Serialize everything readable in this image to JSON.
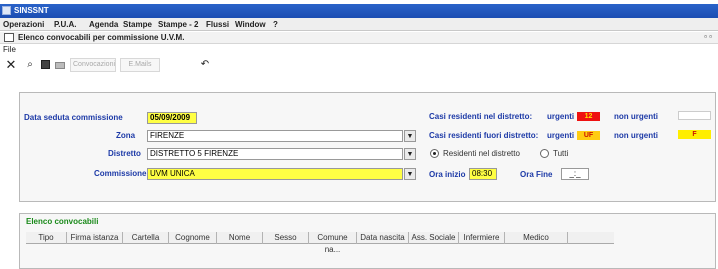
{
  "app": {
    "title": "SINSSNT"
  },
  "menu": [
    "Operazioni",
    "P.U.A.",
    "Agenda",
    "Stampe",
    "Stampe - 2",
    "Flussi",
    "Window",
    "?"
  ],
  "window": {
    "title": "Elenco convocabili per commissione U.V.M.",
    "controls": "▫ ▫"
  },
  "file_menu": "File",
  "toolbar": {
    "convocazioni": "Convocazioni",
    "emails": "E.Mails"
  },
  "form": {
    "data_seduta": {
      "label": "Data seduta commissione",
      "value": "05/09/2009"
    },
    "zona": {
      "label": "Zona",
      "value": "FIRENZE"
    },
    "distretto": {
      "label": "Distretto",
      "value": "DISTRETTO 5 FIRENZE"
    },
    "commissione": {
      "label": "Commissione",
      "value": "UVM UNICA"
    },
    "casi_nel": {
      "label": "Casi residenti nel distretto:",
      "urgenti_label": "urgenti",
      "urgenti_value": "12",
      "non_urgenti_label": "non urgenti",
      "non_urgenti_value": ""
    },
    "casi_fuori": {
      "label": "Casi residenti fuori distretto:",
      "urgenti_label": "urgenti",
      "urgenti_value": "UF",
      "non_urgenti_label": "non urgenti",
      "non_urgenti_value": "F"
    },
    "radio_residenti": "Residenti nel distretto",
    "radio_tutti": "Tutti",
    "ora_inizio": {
      "label": "Ora inizio",
      "value": "08:30"
    },
    "ora_fine": {
      "label": "Ora Fine",
      "value": "_:_"
    }
  },
  "list": {
    "title": "Elenco convocabili",
    "columns": [
      "Tipo",
      "Firma istanza",
      "Cartella",
      "Cognome",
      "Nome",
      "Sesso",
      "Comune na...",
      "Data nascita",
      "Ass. Sociale",
      "Infermiere",
      "Medico"
    ]
  },
  "colors": {
    "urgent": "#ee1111",
    "pending": "#ffee00",
    "field_highlight": "#ffff44"
  }
}
